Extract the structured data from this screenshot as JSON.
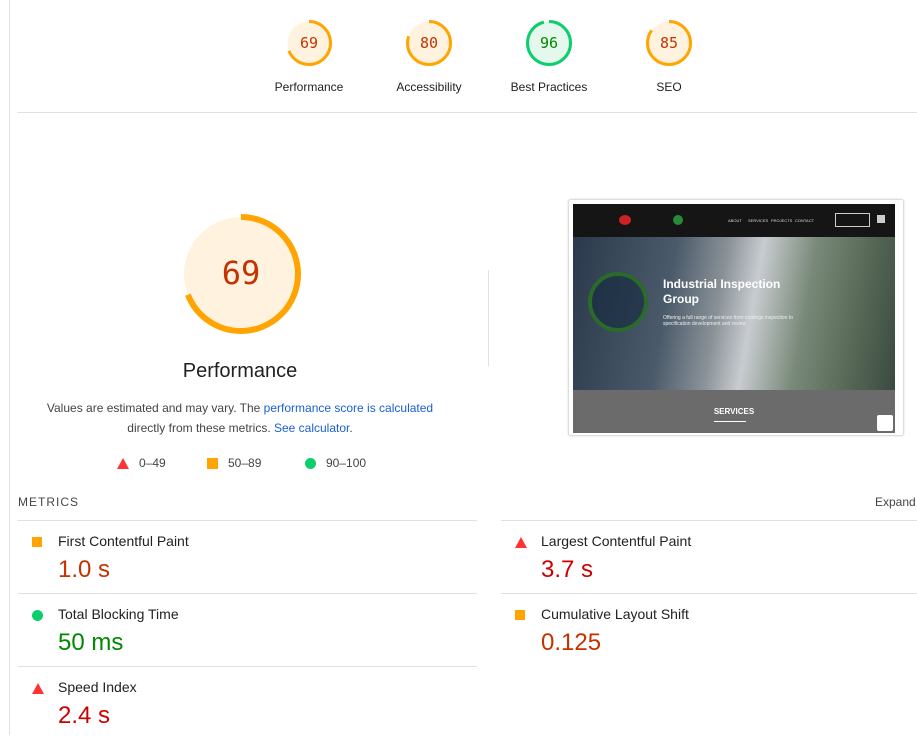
{
  "colors": {
    "orange": "#ffa400",
    "orange_text": "#c33300",
    "green": "#0cce6b",
    "green_text": "#008800",
    "red": "#ff3333"
  },
  "gauges": [
    {
      "label": "Performance",
      "score": 69,
      "rating": "average"
    },
    {
      "label": "Accessibility",
      "score": 80,
      "rating": "average"
    },
    {
      "label": "Best Practices",
      "score": 96,
      "rating": "pass"
    },
    {
      "label": "SEO",
      "score": 85,
      "rating": "average"
    }
  ],
  "main": {
    "score": "69",
    "title": "Performance",
    "desc_1": "Values are estimated and may vary. The ",
    "desc_link1": "performance score is calculated",
    "desc_2": "directly from these metrics. ",
    "desc_link2": "See calculator",
    "desc_3": "."
  },
  "legend": [
    {
      "icon": "triangle",
      "range": "0–49"
    },
    {
      "icon": "square",
      "range": "50–89"
    },
    {
      "icon": "circle",
      "range": "90–100"
    }
  ],
  "screenshot": {
    "hero_title": "Industrial Inspection Group",
    "hero_sub": "Offering a full range of services from coatings inspection to specification development and review",
    "nav": [
      "ABOUT",
      "SERVICES",
      "PROJECTS",
      "CONTACT"
    ],
    "section": "SERVICES"
  },
  "metrics": {
    "header": "METRICS",
    "expand": "Expand view",
    "items": [
      {
        "label": "First Contentful Paint",
        "value": "1.0 s",
        "icon": "square"
      },
      {
        "label": "Largest Contentful Paint",
        "value": "3.7 s",
        "icon": "triangle"
      },
      {
        "label": "Total Blocking Time",
        "value": "50 ms",
        "icon": "circle"
      },
      {
        "label": "Cumulative Layout Shift",
        "value": "0.125",
        "icon": "square"
      },
      {
        "label": "Speed Index",
        "value": "2.4 s",
        "icon": "triangle"
      }
    ]
  }
}
